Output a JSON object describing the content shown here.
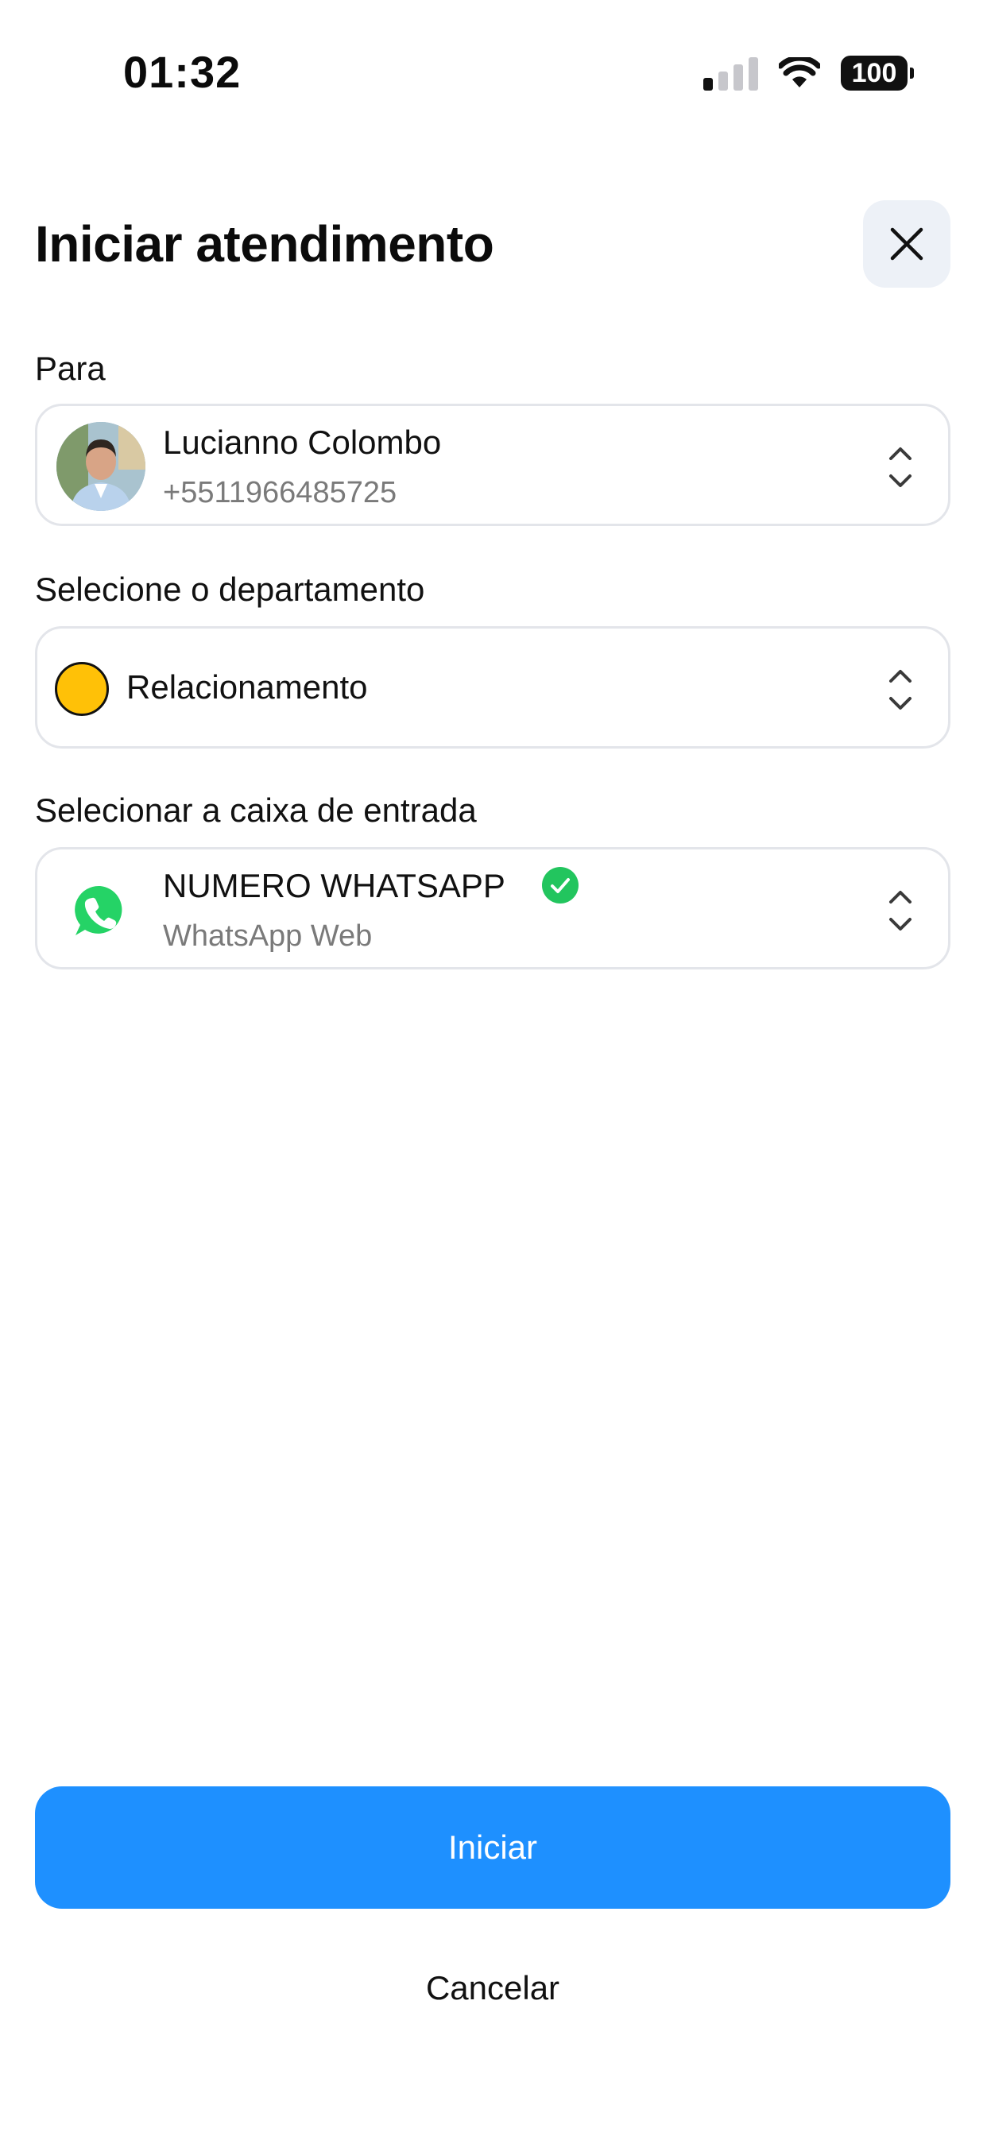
{
  "status_bar": {
    "time": "01:32",
    "battery": "100",
    "signal_icon": "cellular-signal-icon",
    "wifi_icon": "wifi-icon"
  },
  "header": {
    "title": "Iniciar atendimento",
    "close_icon": "close-icon"
  },
  "recipient": {
    "label": "Para",
    "name": "Lucianno Colombo",
    "phone": "+5511966485725"
  },
  "department": {
    "label": "Selecione o departamento",
    "value": "Relacionamento",
    "color": "#FFC107"
  },
  "inbox": {
    "label": "Selecionar a caixa de entrada",
    "name": "NUMERO WHATSAPP",
    "type": "WhatsApp Web",
    "icon": "whatsapp-icon",
    "verified_icon": "verified-check-icon"
  },
  "actions": {
    "start_label": "Iniciar",
    "cancel_label": "Cancelar"
  },
  "colors": {
    "primary": "#1E90FF",
    "whatsapp": "#25D366",
    "verified": "#22C55E"
  }
}
